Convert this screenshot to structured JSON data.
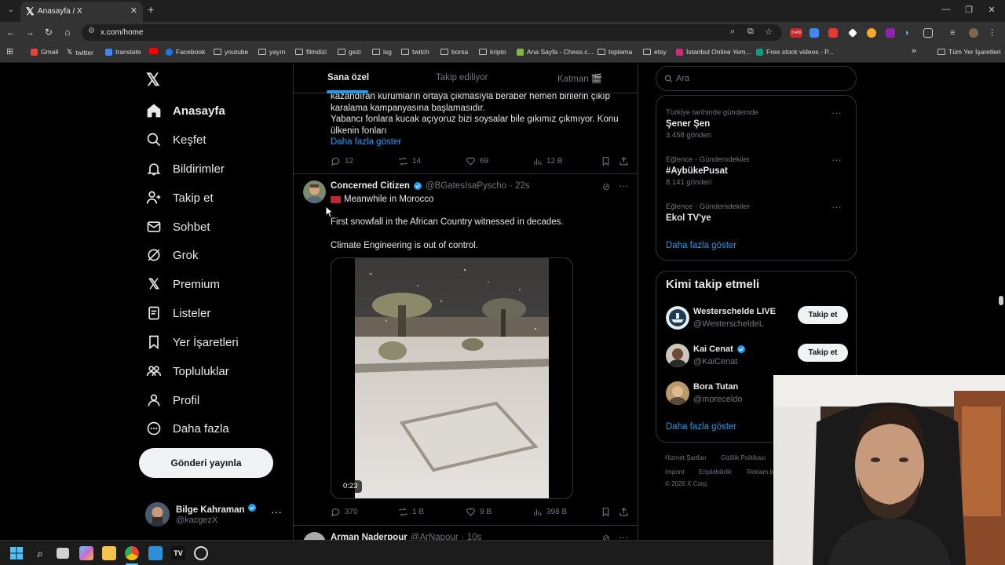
{
  "browser": {
    "tab_title": "Anasayfa / X",
    "url": "x.com/home",
    "bookmarks_overflow": "»",
    "all_bookmarks": "Tüm Yer İşaretleri",
    "bookmarks": [
      {
        "label": "Gmail",
        "icon": "gmail-icon",
        "color": "#ea4335"
      },
      {
        "label": "twitter",
        "icon": "x-icon",
        "color": "#ffffff"
      },
      {
        "label": "translate",
        "icon": "translate-icon",
        "color": "#4285f4"
      },
      {
        "label": "",
        "icon": "youtube-icon",
        "color": "#ff0000"
      },
      {
        "label": "Facebook",
        "icon": "facebook-icon",
        "color": "#1877f2"
      },
      {
        "label": "youtube",
        "icon": "folder-icon"
      },
      {
        "label": "yayın",
        "icon": "folder-icon"
      },
      {
        "label": "filmdizi",
        "icon": "folder-icon"
      },
      {
        "label": "gezi",
        "icon": "folder-icon"
      },
      {
        "label": "isg",
        "icon": "folder-icon"
      },
      {
        "label": "twitch",
        "icon": "folder-icon"
      },
      {
        "label": "borsa",
        "icon": "folder-icon"
      },
      {
        "label": "kripto",
        "icon": "folder-icon"
      },
      {
        "label": "Ana Sayfa - Chess.c...",
        "icon": "chess-icon",
        "color": "#81b64c"
      },
      {
        "label": "toplama",
        "icon": "folder-icon"
      },
      {
        "label": "etsy",
        "icon": "folder-icon"
      },
      {
        "label": "İstanbul Online Yem...",
        "icon": "yemek-icon",
        "color": "#d6247f"
      },
      {
        "label": "Free stock videos - P...",
        "icon": "pexels-icon",
        "color": "#05a081"
      }
    ],
    "extension_badge": "2.400"
  },
  "nav": {
    "items": [
      {
        "label": "Anasayfa",
        "icon": "home-icon",
        "active": true
      },
      {
        "label": "Keşfet",
        "icon": "search-icon"
      },
      {
        "label": "Bildirimler",
        "icon": "bell-icon"
      },
      {
        "label": "Takip et",
        "icon": "follow-icon"
      },
      {
        "label": "Sohbet",
        "icon": "mail-icon"
      },
      {
        "label": "Grok",
        "icon": "grok-icon"
      },
      {
        "label": "Premium",
        "icon": "x-premium-icon"
      },
      {
        "label": "Listeler",
        "icon": "list-icon"
      },
      {
        "label": "Yer İşaretleri",
        "icon": "bookmark-icon"
      },
      {
        "label": "Topluluklar",
        "icon": "communities-icon"
      },
      {
        "label": "Profil",
        "icon": "profile-icon"
      },
      {
        "label": "Daha fazla",
        "icon": "more-circle-icon"
      }
    ],
    "post_button": "Gönderi yayınla",
    "user": {
      "name": "Bilge Kahraman",
      "handle": "@kacgezX"
    }
  },
  "timeline": {
    "tabs": [
      "Sana özel",
      "Takip ediliyor",
      "Katman 🎬"
    ],
    "post1": {
      "text_lines": [
        "kazandıran kurumların ortaya çıkmasıyla beraber hemen birilerin çıkıp",
        "karalama kampanyasına başlamasıdır.",
        "Yabancı fonlara kucak açıyoruz bizi soysalar bile gıkımız çıkmıyor. Konu",
        "ülkenin fonları"
      ],
      "show_more": "Daha fazla göster",
      "replies": "12",
      "reposts": "14",
      "likes": "69",
      "views": "12 B"
    },
    "post2": {
      "name": "Concerned Citizen",
      "handle": "@BGatesIsaPyscho",
      "time": "· 22s",
      "line1": "Meanwhile in Morocco",
      "line2": "First snowfall in the African Country witnessed in decades.",
      "line3": "Climate Engineering is out of control.",
      "video_duration": "0:23",
      "replies": "370",
      "reposts": "1 B",
      "likes": "9 B",
      "views": "398 B"
    },
    "post3": {
      "name": "Arman Naderpour",
      "handle": "@ArNapour",
      "time": "· 10s"
    }
  },
  "sidebar": {
    "search_placeholder": "Ara",
    "trends": [
      {
        "meta": "Türkiye tarihinde gündemde",
        "title": "Şener Şen",
        "count": "3.458 gönderi"
      },
      {
        "meta": "Eğlence · Gündemdekiler",
        "title": "#AybükePusat",
        "count": "8.141 gönderi"
      },
      {
        "meta": "Eğlence · Gündemdekiler",
        "title": "Ekol TV'ye",
        "count": ""
      }
    ],
    "trends_show_more": "Daha fazla göster",
    "who_to_follow": {
      "heading": "Kimi takip etmeli",
      "users": [
        {
          "name": "Westerschelde LIVE",
          "handle": "@WesterscheldeL",
          "button": "Takip et",
          "verified": false
        },
        {
          "name": "Kai Cenat",
          "handle": "@KaiCenat",
          "button": "Takip et",
          "verified": true
        },
        {
          "name": "Bora Tutan",
          "handle": "@moreceldo",
          "button": "",
          "verified": false
        }
      ],
      "show_more": "Daha fazla göster"
    },
    "footer": [
      "Hizmet Şartları",
      "Gizlilik Politikası",
      "Imprint",
      "Erişilebilirlik",
      "Reklam b",
      "© 2026 X Corp."
    ]
  },
  "colors": {
    "accent": "#1d9bf0",
    "bg": "#000000",
    "text": "#e7e9ea",
    "muted": "#71767b",
    "border": "#2f3336"
  }
}
